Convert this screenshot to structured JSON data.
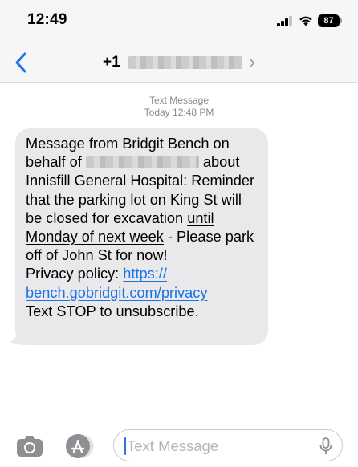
{
  "status_bar": {
    "time": "12:49",
    "battery": "87"
  },
  "nav": {
    "contact_prefix": "+1"
  },
  "thread": {
    "service_label": "Text Message",
    "timestamp": "Today 12:48 PM",
    "message": {
      "p1": "Message from Bridgit Bench on behalf of",
      "p2": "about Innisfill General Hospital: Reminder that the parking lot on King St will be closed for excavation",
      "underlined": "until Monday of next week",
      "p3": "- Please park off of John St for now!",
      "privacy_label": "Privacy policy:",
      "privacy_link": "https:// bench.gobridgit.com/privacy",
      "footer": "Text STOP to unsubscribe."
    }
  },
  "compose": {
    "placeholder": "Text Message"
  },
  "icons": {
    "back": "chevron-left",
    "contact_details": "chevron-right",
    "camera": "camera",
    "apps": "app-store",
    "mic": "microphone"
  },
  "colors": {
    "accent": "#1a73e8",
    "bubble": "#e9e9eb",
    "header": "#f6f6f7"
  }
}
